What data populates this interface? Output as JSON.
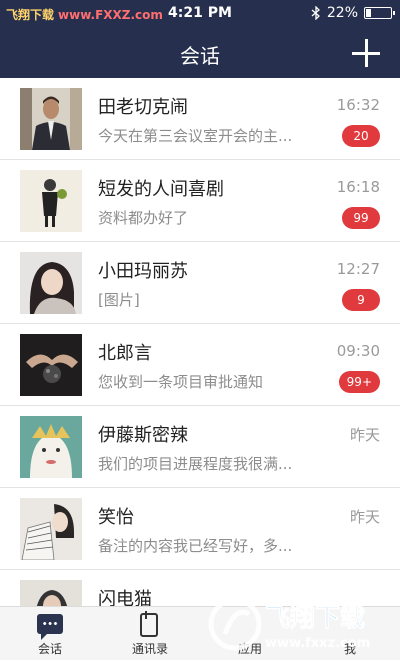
{
  "status_bar": {
    "brand": "飞翔下载",
    "brand_url": "www.FXXZ.com",
    "time": "4:21 PM",
    "battery": "22%",
    "battery_level": 0.22
  },
  "nav": {
    "title": "会话"
  },
  "conversations": [
    {
      "name": "田老切克闹",
      "preview": "今天在第三会议室开会的主...",
      "time": "16:32",
      "badge": "20"
    },
    {
      "name": "短发的人间喜剧",
      "preview": "资料都办好了",
      "time": "16:18",
      "badge": "99"
    },
    {
      "name": "小田玛丽苏",
      "preview": "[图片]",
      "time": "12:27",
      "badge": "9"
    },
    {
      "name": "北郎言",
      "preview": "您收到一条项目审批通知",
      "time": "09:30",
      "badge": "99+"
    },
    {
      "name": "伊藤斯密辣",
      "preview": "我们的项目进展程度我很满...",
      "time": "昨天",
      "badge": ""
    },
    {
      "name": "笑怡",
      "preview": "备注的内容我已经写好，多...",
      "time": "昨天",
      "badge": ""
    },
    {
      "name": "闪电猫",
      "preview": "",
      "time": "",
      "badge": ""
    }
  ],
  "tabs": [
    {
      "label": "会话",
      "icon": "chat-icon"
    },
    {
      "label": "通讯录",
      "icon": "contacts-icon"
    },
    {
      "label": "应用",
      "icon": "apps-icon"
    },
    {
      "label": "我",
      "icon": "me-icon"
    }
  ],
  "watermark": {
    "text": "飞翔下载",
    "url": "www.fxxz.com"
  },
  "colors": {
    "header": "#262f4d",
    "badge": "#e0393e"
  }
}
